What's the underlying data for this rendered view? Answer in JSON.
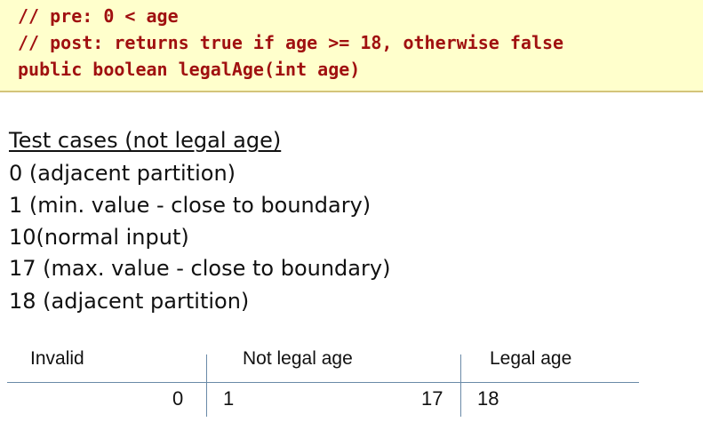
{
  "code": {
    "lines": [
      "// pre: 0 < age",
      "// post: returns true if age >= 18, otherwise false",
      "public boolean legalAge(int age)"
    ]
  },
  "test_cases": {
    "heading": "Test cases (not legal age)",
    "items": [
      "0 (adjacent partition)",
      "1 (min. value - close to boundary)",
      "10(normal input)",
      "17 (max. value - close to boundary)",
      "18 (adjacent partition)"
    ]
  },
  "partition_table": {
    "labels": [
      "Invalid",
      "Not legal age",
      "Legal age"
    ],
    "values": [
      "0",
      "1",
      "17",
      "18"
    ]
  }
}
